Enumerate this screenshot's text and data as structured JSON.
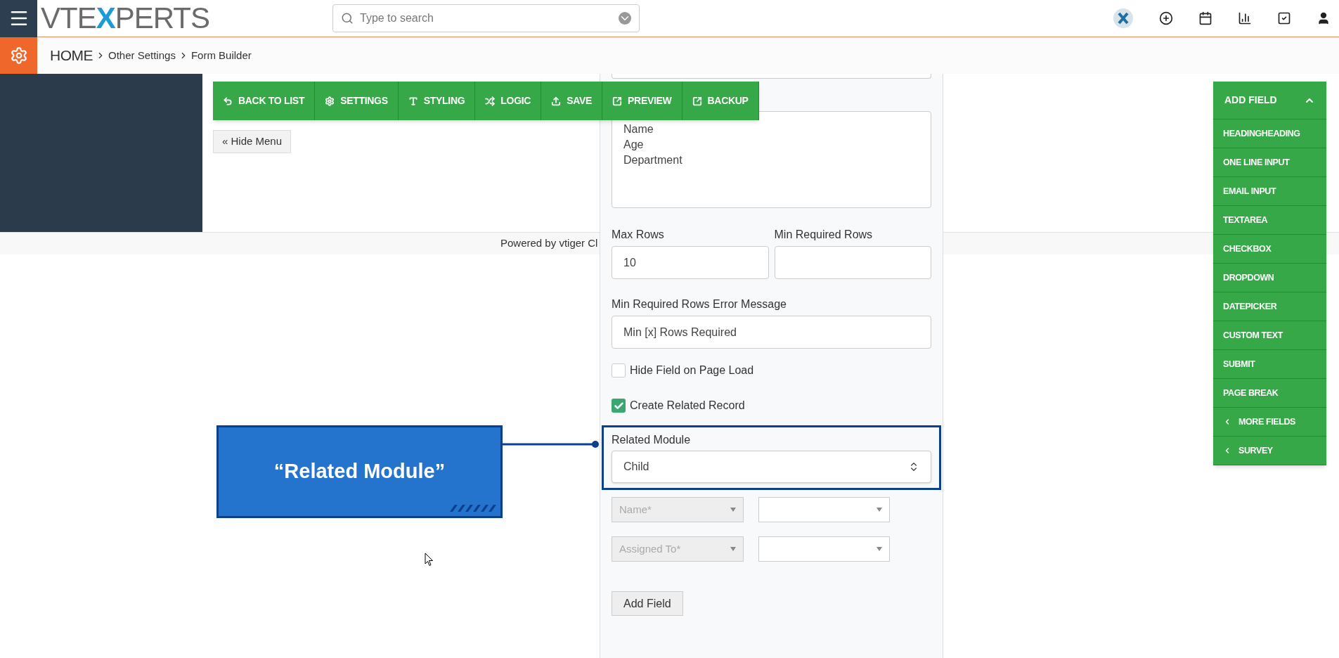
{
  "header": {
    "logo": {
      "text_before": "VTE",
      "accent": "X",
      "text_after": "PERTS"
    },
    "search": {
      "placeholder": "Type to search"
    }
  },
  "breadcrumb": [
    {
      "label": "HOME",
      "kind": "home"
    },
    {
      "label": "Other Settings",
      "kind": "link"
    },
    {
      "label": "Form Builder",
      "kind": "link"
    }
  ],
  "toolbar": [
    {
      "label": "BACK TO LIST",
      "kind": "back"
    },
    {
      "label": "SETTINGS",
      "kind": "settings"
    },
    {
      "label": "STYLING",
      "kind": "styling"
    },
    {
      "label": "LOGIC",
      "kind": "logic"
    },
    {
      "label": "SAVE",
      "kind": "save"
    },
    {
      "label": "PREVIEW",
      "kind": "preview"
    },
    {
      "label": "BACKUP",
      "kind": "backup"
    }
  ],
  "hide_menu": "« Hide Menu",
  "footer": "Powered by vtiger Cl",
  "form": {
    "textarea_lines": [
      "Name",
      "Age",
      "Department"
    ],
    "max_rows": {
      "label": "Max Rows",
      "value": "10"
    },
    "min_required_rows": {
      "label": "Min Required Rows"
    },
    "error_message": {
      "label": "Min Required Rows Error Message",
      "value": "Min [x] Rows Required"
    },
    "checkboxes": [
      {
        "label": "Hide Field on Page Load",
        "checked": false
      },
      {
        "label": "Create Related Record",
        "checked": true
      }
    ],
    "related_module": {
      "label": "Related Module",
      "value": "Child"
    },
    "mappings": [
      {
        "field": "Name*"
      },
      {
        "field": "Assigned To*"
      }
    ],
    "add_field_button": "Add Field"
  },
  "callout": {
    "text": "“Related Module”"
  },
  "add_field_panel": {
    "title": "ADD FIELD",
    "expanded": true,
    "items": [
      {
        "label": "HEADINGHEADING",
        "kind": "field"
      },
      {
        "label": "ONE LINE INPUT",
        "kind": "field"
      },
      {
        "label": "EMAIL INPUT",
        "kind": "field"
      },
      {
        "label": "TEXTAREA",
        "kind": "field"
      },
      {
        "label": "CHECKBOX",
        "kind": "field"
      },
      {
        "label": "DROPDOWN",
        "kind": "field"
      },
      {
        "label": "DATEPICKER",
        "kind": "field"
      },
      {
        "label": "CUSTOM TEXT",
        "kind": "field"
      },
      {
        "label": "SUBMIT",
        "kind": "field"
      },
      {
        "label": "PAGE BREAK",
        "kind": "field"
      },
      {
        "label": "MORE FIELDS",
        "kind": "submenu"
      },
      {
        "label": "SURVEY",
        "kind": "submenu"
      }
    ]
  }
}
